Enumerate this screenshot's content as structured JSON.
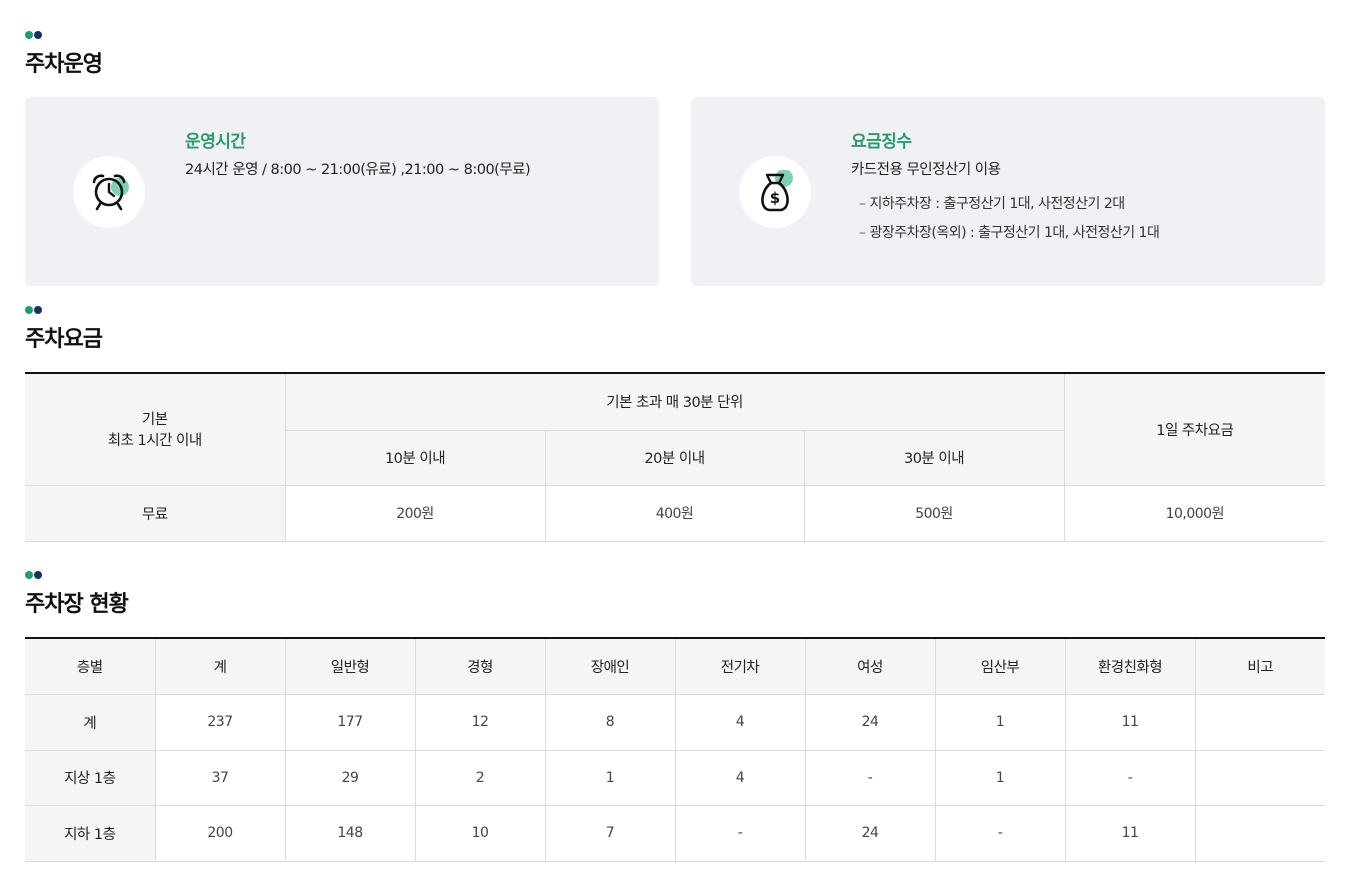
{
  "sections": {
    "operation_title": "주차운영",
    "fee_title": "주차요금",
    "status_title": "주차장 현황"
  },
  "hours_card": {
    "title": "운영시간",
    "text": "24시간 운영 / 8:00 ~ 21:00(유료) ,21:00 ~ 8:00(무료)",
    "icon": "alarm-clock-icon"
  },
  "payment_card": {
    "title": "요금징수",
    "text": "카드전용 무인정산기 이용",
    "items": [
      "지하주차장 : 출구정산기 1대, 사전정산기 2대",
      "광장주차장(옥외) : 출구정산기 1대, 사전정산기 1대"
    ],
    "icon": "money-bag-icon"
  },
  "fee_table": {
    "basic_header_line1": "기본",
    "basic_header_line2": "최초 1시간 이내",
    "extra_header": "기본 초과 매 30분 단위",
    "sub_headers": [
      "10분 이내",
      "20분 이내",
      "30분 이내"
    ],
    "daily_header": "1일 주차요금",
    "row": [
      "무료",
      "200원",
      "400원",
      "500원",
      "10,000원"
    ]
  },
  "status_table": {
    "headers": [
      "층별",
      "계",
      "일반형",
      "경형",
      "장애인",
      "전기차",
      "여성",
      "임산부",
      "환경친화형",
      "비고"
    ],
    "rows": [
      [
        "계",
        "237",
        "177",
        "12",
        "8",
        "4",
        "24",
        "1",
        "11",
        ""
      ],
      [
        "지상 1층",
        "37",
        "29",
        "2",
        "1",
        "4",
        "-",
        "1",
        "-",
        ""
      ],
      [
        "지하 1층",
        "200",
        "148",
        "10",
        "7",
        "-",
        "24",
        "-",
        "11",
        ""
      ]
    ]
  },
  "colors": {
    "accent_green": "#2a9a6e",
    "dot_green": "#1d9a78",
    "dot_navy": "#173258",
    "card_bg": "#f0f1f5"
  }
}
